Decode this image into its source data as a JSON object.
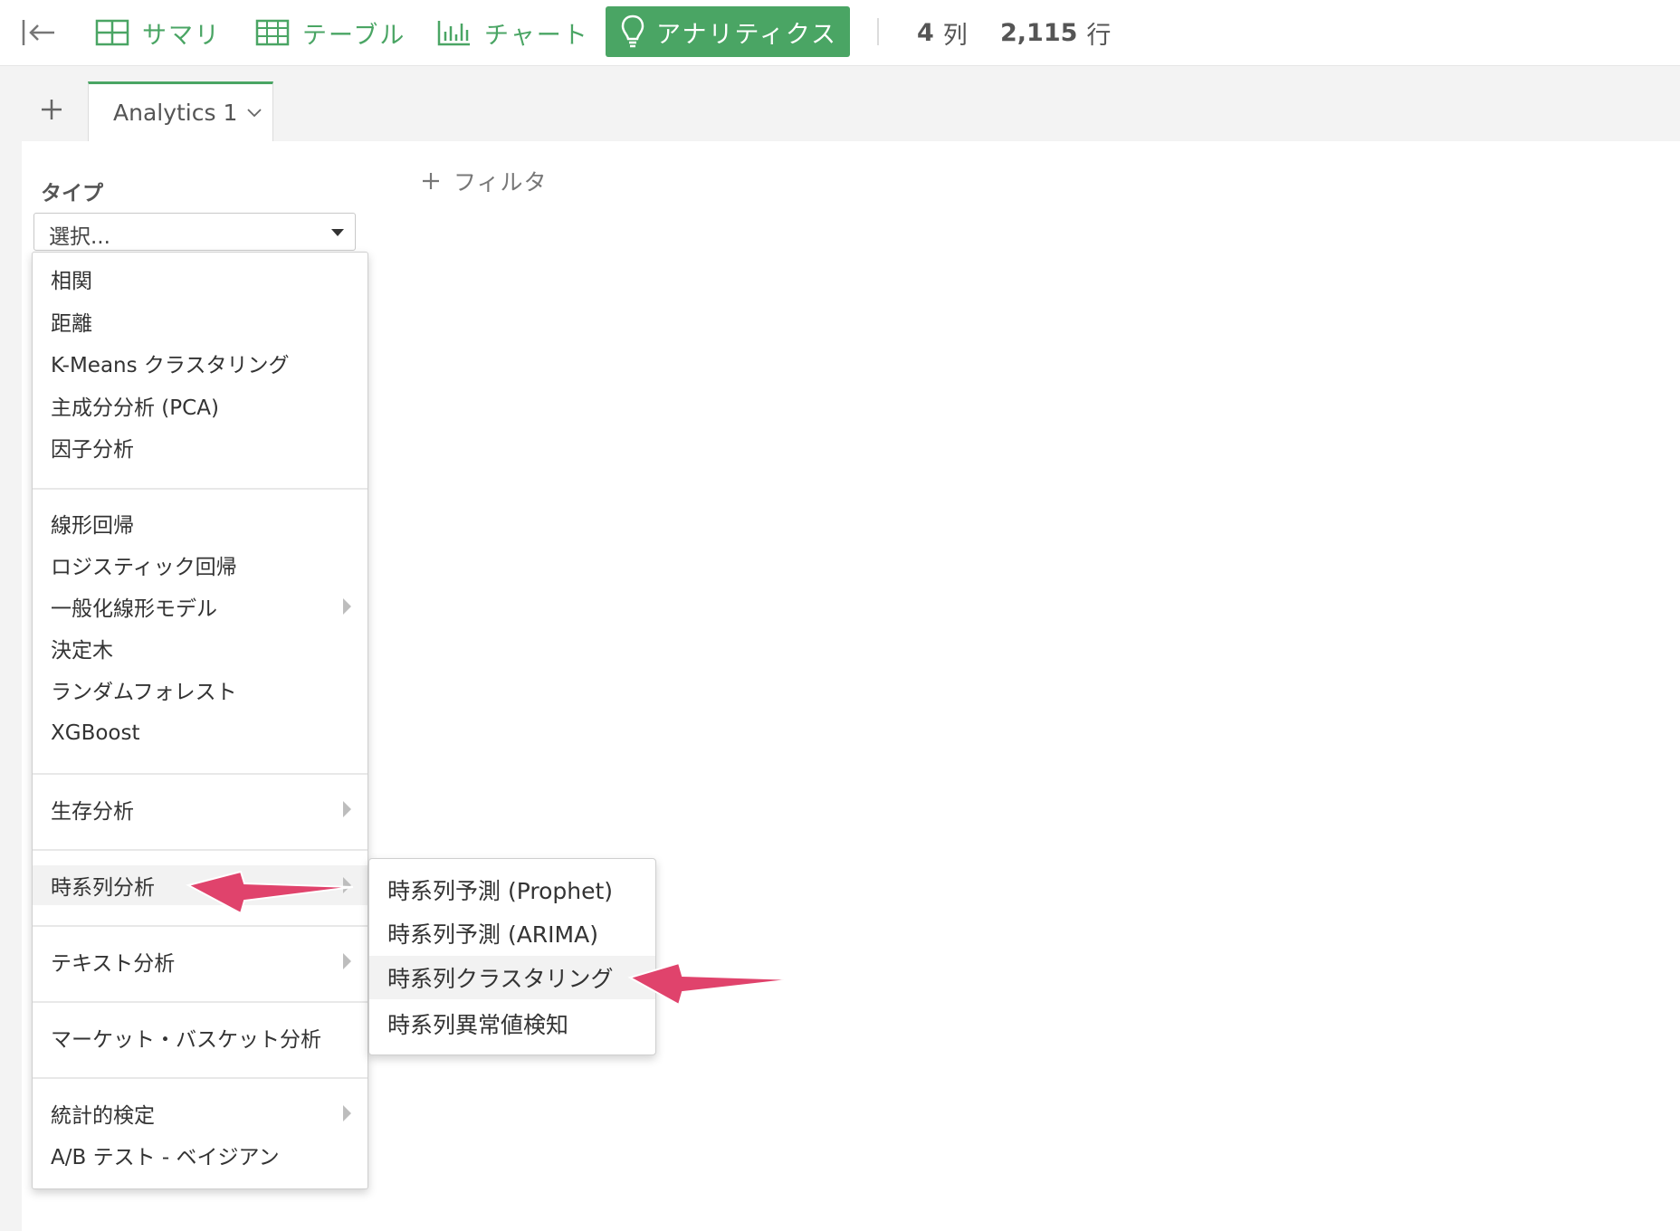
{
  "toolbar": {
    "items": [
      {
        "label": "サマリ",
        "icon": "summary-grid-icon"
      },
      {
        "label": "テーブル",
        "icon": "table-icon"
      },
      {
        "label": "チャート",
        "icon": "bar-chart-icon"
      }
    ],
    "active": {
      "label": "アナリティクス",
      "icon": "lightbulb-icon"
    },
    "columns_count": "4",
    "columns_unit": "列",
    "rows_count": "2,115",
    "rows_unit": "行",
    "accent_color": "#4aa564"
  },
  "tabs": {
    "active_label": "Analytics 1"
  },
  "panel": {
    "type_label": "タイプ",
    "select_placeholder": "選択...",
    "filter_label": "フィルタ"
  },
  "menu": {
    "group1": [
      "相関",
      "距離",
      "K-Means クラスタリング",
      "主成分分析 (PCA)",
      "因子分析"
    ],
    "group2": [
      "線形回帰",
      "ロジスティック回帰",
      "一般化線形モデル",
      "決定木",
      "ランダムフォレスト",
      "XGBoost"
    ],
    "survival": "生存分析",
    "timeseries": "時系列分析",
    "text": "テキスト分析",
    "market": "マーケット・バスケット分析",
    "group_last": [
      "統計的検定",
      "A/B テスト - ベイジアン"
    ]
  },
  "submenu": {
    "items": [
      "時系列予測 (Prophet)",
      "時系列予測 (ARIMA)",
      "時系列クラスタリング",
      "時系列異常値検知"
    ],
    "highlighted_index": 2
  },
  "annotation_color": "#e0436c"
}
